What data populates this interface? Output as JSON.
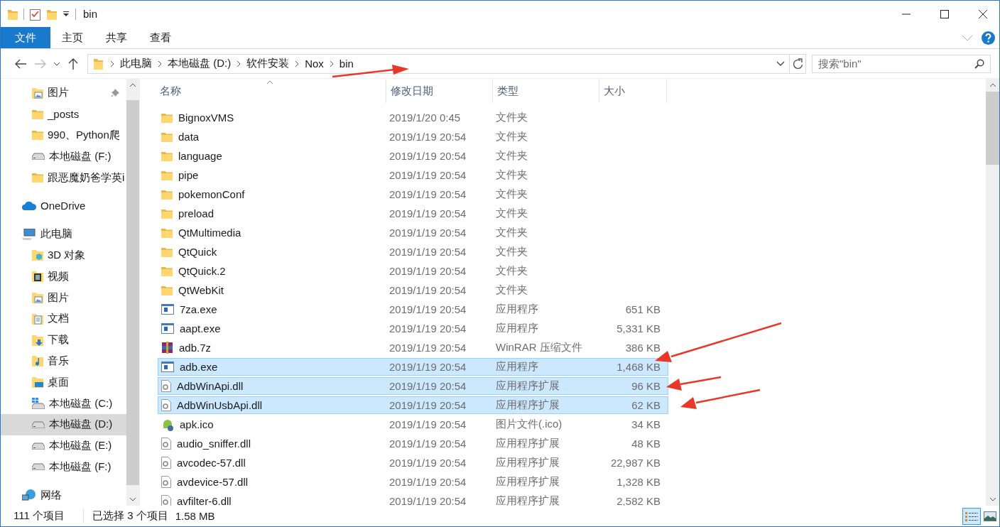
{
  "window": {
    "title": "bin"
  },
  "ribbon": {
    "tabs": [
      {
        "label": "文件",
        "kind": "file",
        "selected": false
      },
      {
        "label": "主页",
        "kind": "tab",
        "selected": false
      },
      {
        "label": "共享",
        "kind": "tab",
        "selected": false
      },
      {
        "label": "查看",
        "kind": "tab",
        "selected": false
      }
    ]
  },
  "address_bar": {
    "path": [
      "此电脑",
      "本地磁盘 (D:)",
      "软件安装",
      "Nox",
      "bin"
    ],
    "search": {
      "placeholder": "搜索\"bin\""
    }
  },
  "sidebar": {
    "items": [
      {
        "label": "图片",
        "kind": "pictures",
        "pinned": true,
        "selected": false
      },
      {
        "label": "_posts",
        "kind": "folder",
        "pinned": false,
        "selected": false
      },
      {
        "label": "990、Python爬",
        "kind": "folder",
        "pinned": false,
        "selected": false
      },
      {
        "label": "本地磁盘 (F:)",
        "kind": "drive",
        "pinned": false,
        "selected": false
      },
      {
        "label": "跟恶魔奶爸学英i",
        "kind": "folder",
        "pinned": false,
        "selected": false
      },
      {
        "label": "OneDrive",
        "kind": "cloud",
        "pinned": false,
        "selected": false,
        "group": true
      },
      {
        "label": "此电脑",
        "kind": "pc",
        "pinned": false,
        "selected": false,
        "group": true,
        "children": [
          {
            "label": "3D 对象",
            "kind": "objects3d",
            "pinned": false,
            "selected": false
          },
          {
            "label": "视频",
            "kind": "video",
            "pinned": false,
            "selected": false
          },
          {
            "label": "图片",
            "kind": "pictures",
            "pinned": false,
            "selected": false
          },
          {
            "label": "文档",
            "kind": "documents",
            "pinned": false,
            "selected": false
          },
          {
            "label": "下载",
            "kind": "downloads",
            "pinned": false,
            "selected": false
          },
          {
            "label": "音乐",
            "kind": "music",
            "pinned": false,
            "selected": false
          },
          {
            "label": "桌面",
            "kind": "desktop",
            "pinned": false,
            "selected": false
          },
          {
            "label": "本地磁盘 (C:)",
            "kind": "system-drive",
            "pinned": false,
            "selected": false
          },
          {
            "label": "本地磁盘 (D:)",
            "kind": "drive",
            "pinned": false,
            "selected": true
          },
          {
            "label": "本地磁盘 (E:)",
            "kind": "drive",
            "pinned": false,
            "selected": false
          },
          {
            "label": "本地磁盘 (F:)",
            "kind": "drive",
            "pinned": false,
            "selected": false
          }
        ]
      },
      {
        "label": "网络",
        "kind": "network",
        "pinned": false,
        "selected": false,
        "group": true
      }
    ]
  },
  "file_list": {
    "columns": [
      "名称",
      "修改日期",
      "类型",
      "大小"
    ],
    "rows": [
      {
        "name": "BignoxVMS",
        "date": "2019/1/20 0:45",
        "type": "文件夹",
        "size": "",
        "kind": "folder",
        "selected": false
      },
      {
        "name": "data",
        "date": "2019/1/19 20:54",
        "type": "文件夹",
        "kind": "folder",
        "selected": false
      },
      {
        "name": "language",
        "date": "2019/1/19 20:54",
        "type": "文件夹",
        "kind": "folder",
        "selected": false
      },
      {
        "name": "pipe",
        "date": "2019/1/19 20:54",
        "type": "文件夹",
        "kind": "folder",
        "selected": false
      },
      {
        "name": "pokemonConf",
        "date": "2019/1/19 20:54",
        "type": "文件夹",
        "kind": "folder",
        "selected": false
      },
      {
        "name": "preload",
        "date": "2019/1/19 20:54",
        "type": "文件夹",
        "kind": "folder",
        "selected": false
      },
      {
        "name": "QtMultimedia",
        "date": "2019/1/19 20:54",
        "type": "文件夹",
        "kind": "folder",
        "selected": false
      },
      {
        "name": "QtQuick",
        "date": "2019/1/19 20:54",
        "type": "文件夹",
        "kind": "folder",
        "selected": false
      },
      {
        "name": "QtQuick.2",
        "date": "2019/1/19 20:54",
        "type": "文件夹",
        "kind": "folder",
        "selected": false
      },
      {
        "name": "QtWebKit",
        "date": "2019/1/19 20:54",
        "type": "文件夹",
        "kind": "folder",
        "selected": false
      },
      {
        "name": "7za.exe",
        "date": "2019/1/19 20:54",
        "type": "应用程序",
        "size": "651 KB",
        "kind": "exe",
        "selected": false
      },
      {
        "name": "aapt.exe",
        "date": "2019/1/19 20:54",
        "type": "应用程序",
        "size": "5,331 KB",
        "kind": "exe",
        "selected": false
      },
      {
        "name": "adb.7z",
        "date": "2019/1/19 20:54",
        "type": "WinRAR 压缩文件",
        "size": "386 KB",
        "kind": "archive",
        "selected": false
      },
      {
        "name": "adb.exe",
        "date": "2019/1/19 20:54",
        "type": "应用程序",
        "size": "1,468 KB",
        "kind": "exe",
        "selected": true
      },
      {
        "name": "AdbWinApi.dll",
        "date": "2019/1/19 20:54",
        "type": "应用程序扩展",
        "size": "96 KB",
        "kind": "dll",
        "selected": true
      },
      {
        "name": "AdbWinUsbApi.dll",
        "date": "2019/1/19 20:54",
        "type": "应用程序扩展",
        "size": "62 KB",
        "kind": "dll",
        "selected": true
      },
      {
        "name": "apk.ico",
        "date": "2019/1/19 20:54",
        "type": "图片文件(.ico)",
        "size": "34 KB",
        "kind": "icon-file",
        "selected": false
      },
      {
        "name": "audio_sniffer.dll",
        "date": "2019/1/19 20:54",
        "type": "应用程序扩展",
        "size": "48 KB",
        "kind": "dll",
        "selected": false
      },
      {
        "name": "avcodec-57.dll",
        "date": "2019/1/19 20:54",
        "type": "应用程序扩展",
        "size": "22,987 KB",
        "kind": "dll",
        "selected": false
      },
      {
        "name": "avdevice-57.dll",
        "date": "2019/1/19 20:54",
        "type": "应用程序扩展",
        "size": "1,328 KB",
        "kind": "dll",
        "selected": false
      },
      {
        "name": "avfilter-6.dll",
        "date": "2019/1/19 20:54",
        "type": "应用程序扩展",
        "size": "2,582 KB",
        "kind": "dll",
        "selected": false
      }
    ]
  },
  "status_bar": {
    "count": "111 个项目",
    "selection": "已选择 3 个项目",
    "selection_size": "1.58 MB",
    "views": [
      {
        "kind": "details",
        "selected": true
      },
      {
        "kind": "thumbnails",
        "selected": false
      }
    ]
  }
}
